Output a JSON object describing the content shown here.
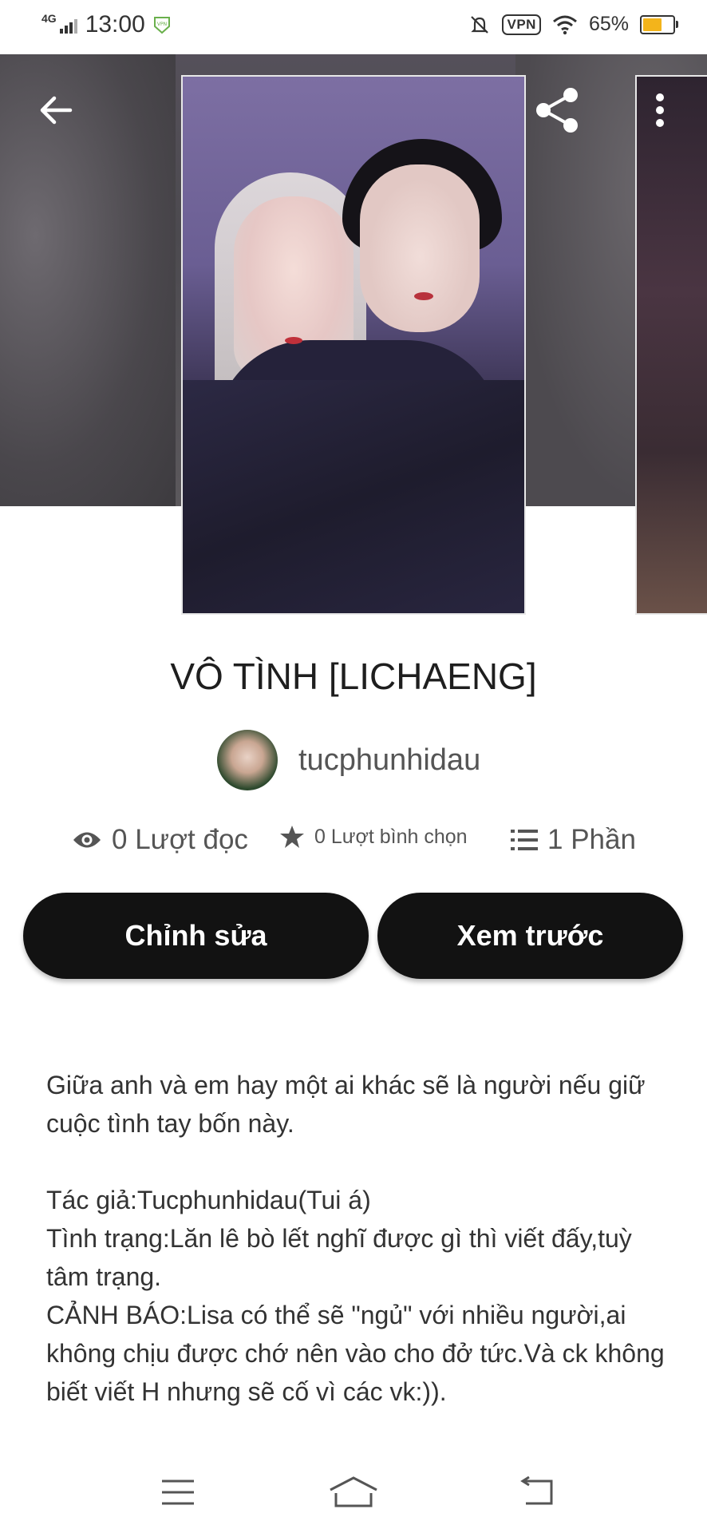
{
  "status_bar": {
    "network": "4G",
    "time": "13:00",
    "vpn_label": "VPN",
    "battery": "65%",
    "battery_level": 0.65,
    "icons": [
      "signal-icon",
      "vpn-shield-icon",
      "mute-icon",
      "vpn-icon",
      "wifi-icon",
      "battery-icon"
    ]
  },
  "header": {
    "back_icon": "arrow-left-icon",
    "share_icon": "share-icon",
    "more_icon": "more-vertical-icon"
  },
  "story": {
    "title": "VÔ TÌNH [LICHAENG]",
    "author": "tucphunhidau",
    "stats": {
      "reads": "0 Lượt đọc",
      "votes": "0 Lượt bình chọn",
      "parts": "1 Phần"
    },
    "buttons": {
      "edit": "Chỉnh sửa",
      "preview": "Xem trước"
    },
    "description": {
      "line1": "Giữa anh và em hay một ai khác sẽ là người nếu giữ cuộc tình tay bốn này.",
      "author_line": "Tác giả:Tucphunhidau(Tui á)",
      "status_line": "Tình trạng:Lăn lê bò lết nghĩ được gì thì viết đấy,tuỳ tâm trạng.",
      "warning_line": "CẢNH BÁO:Lisa có thể sẽ \"ngủ\" với nhiều người,ai không chịu được chớ nên vào cho đở tức.Và ck không biết viết H nhưng sẽ cố vì các vk:))."
    }
  },
  "nav_bar": {
    "icons": [
      "menu-icon",
      "home-icon",
      "back-nav-icon"
    ]
  },
  "colors": {
    "button_bg": "#121212",
    "battery": "#f3b41b",
    "vpn_green": "#6ab04c"
  }
}
